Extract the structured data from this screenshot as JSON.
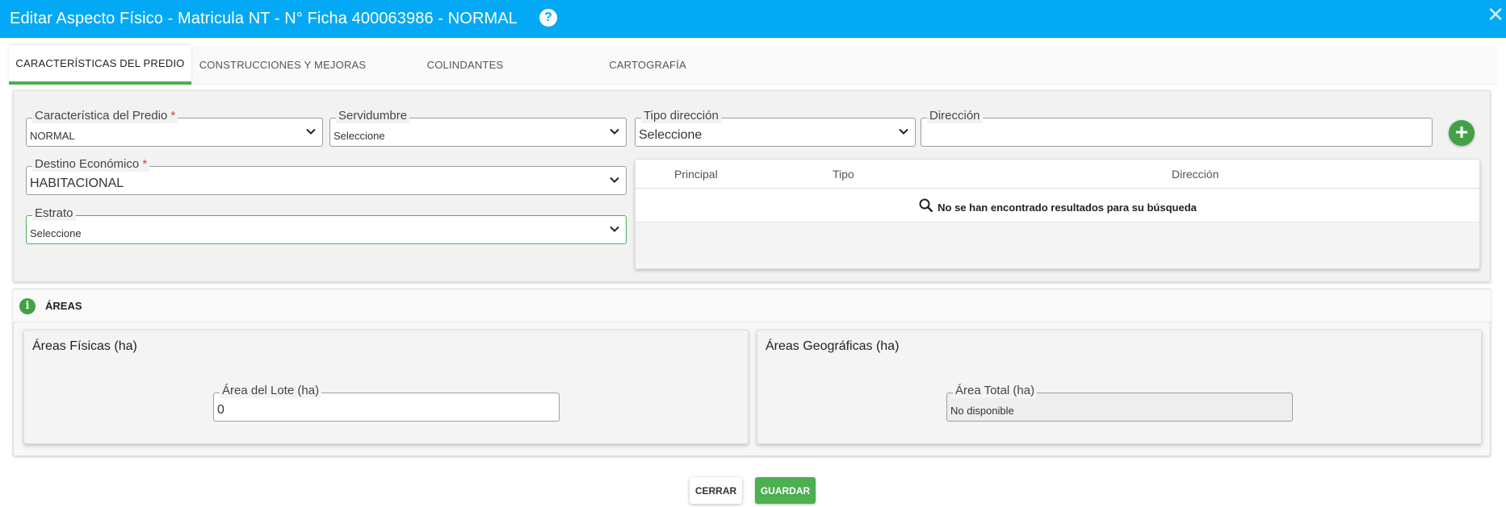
{
  "dialog": {
    "title": "Editar Aspecto Físico - Matricula NT - N° Ficha 400063986 - NORMAL",
    "help_glyph": "?",
    "close_glyph": "✕"
  },
  "tabs": [
    {
      "label": "CARACTERÍSTICAS DEL PREDIO",
      "active": true
    },
    {
      "label": "CONSTRUCCIONES Y MEJORAS",
      "active": false
    },
    {
      "label": "COLINDANTES",
      "active": false
    },
    {
      "label": "CARTOGRAFÍA",
      "active": false
    }
  ],
  "form": {
    "caracteristica": {
      "label": "Característica del Predio",
      "required_mark": "*",
      "value": "NORMAL"
    },
    "servidumbre": {
      "label": "Servidumbre",
      "value": "Seleccione"
    },
    "tipo_direccion": {
      "label": "Tipo dirección",
      "value": "Seleccione"
    },
    "direccion": {
      "label": "Dirección",
      "value": ""
    },
    "destino": {
      "label": "Destino Económico",
      "required_mark": "*",
      "value": "HABITACIONAL"
    },
    "estrato": {
      "label": "Estrato",
      "value": "Seleccione"
    },
    "add_glyph": "+"
  },
  "address_table": {
    "columns": [
      "Principal",
      "Tipo",
      "Dirección"
    ],
    "empty_message": "No se han encontrado resultados para su búsqueda"
  },
  "areas": {
    "section_title": "ÁREAS",
    "info_glyph": "i",
    "fisicas": {
      "title": "Áreas Físicas (ha)",
      "field_label": "Área del Lote (ha)",
      "value": "0"
    },
    "geograficas": {
      "title": "Áreas Geográficas (ha)",
      "field_label": "Área Total (ha)",
      "value": "No disponible"
    }
  },
  "actions": {
    "cerrar": "CERRAR",
    "guardar": "GUARDAR"
  },
  "colors": {
    "titlebar": "#03a9f4",
    "accent_green": "#4caf50",
    "required": "#e53935"
  },
  "icons": [
    "help-icon",
    "close-icon",
    "chevron-down-icon",
    "add-icon",
    "search-icon",
    "info-icon"
  ]
}
